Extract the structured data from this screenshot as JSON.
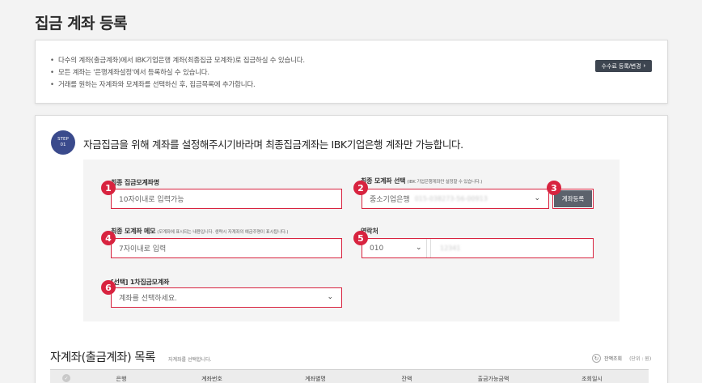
{
  "page": {
    "title": "집금 계좌 등록"
  },
  "notice": {
    "items": [
      "다수의 계좌(출금계좌)에서 IBK기업은행 계좌(최종집금 모계좌)로 집금하실 수 있습니다.",
      "모든 계좌는 '은행계좌설정'에서 등록하실 수 있습니다.",
      "거래를 원하는 자계좌와 모계좌를 선택하신 후, 집금목록에 추가합니다."
    ],
    "fee_button_label": "수수료 등록/변경",
    "fee_button_icon": "chevron-right-icon"
  },
  "step": {
    "badge_label": "STEP",
    "badge_number": "01",
    "title": "자금집금을 위해 계좌를 설정해주시기바라며 최종집금계좌는 IBK기업은행 계좌만 가능합니다."
  },
  "form": {
    "final_name": {
      "label": "최종 집금모계좌명",
      "placeholder": "10자이내로 입력가능",
      "badge": "1"
    },
    "final_select": {
      "label": "최종 모계좌 선택",
      "sublabel": "(IBK 기업은행계좌만 설정할 수 있습니다.)",
      "value": "중소기업은행",
      "masked": "015-038273-56-00913",
      "badge": "2"
    },
    "register_button": {
      "label": "계좌등록",
      "badge": "3"
    },
    "memo": {
      "label": "최종 모계좌 메모",
      "sublabel": "(모계좌에 표시되는 내용입니다. 생략시 자계좌의 예금주명이 표시됩니다.)",
      "placeholder": "7자이내로 입력",
      "badge": "4"
    },
    "contact": {
      "label": "연락처",
      "prefix": "010",
      "masked": "12341",
      "badge": "5"
    },
    "first_account": {
      "label": "[선택] 1차집금모계좌",
      "placeholder": "계좌를 선택하세요.",
      "badge": "6"
    }
  },
  "list": {
    "title": "자계좌(출금계좌) 목록",
    "subtitle": "자계좌를 선택합니다.",
    "refresh_label": "잔액조회",
    "unit_label": "(단위 : 원)",
    "columns": [
      "은행",
      "계좌번호",
      "계좌별명",
      "잔액",
      "출금가능금액",
      "조회일시"
    ]
  }
}
